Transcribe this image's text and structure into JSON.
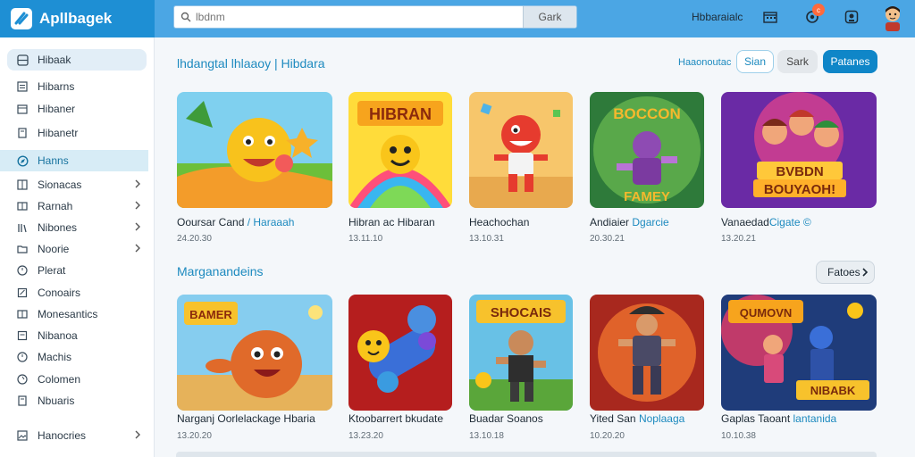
{
  "app": {
    "name": "Apllbagek"
  },
  "header": {
    "search_placeholder": "lbdnm",
    "search_button": "Gark",
    "link": "Hbbaraialc",
    "notification_badge": "c"
  },
  "sidebar": {
    "items": [
      {
        "label": "Hibaak",
        "icon": "grid-icon",
        "chevron": false
      },
      {
        "label": "Hibarns",
        "icon": "list-icon",
        "chevron": false
      },
      {
        "label": "Hibaner",
        "icon": "calendar-icon",
        "chevron": false
      },
      {
        "label": "Hibanetr",
        "icon": "document-icon",
        "chevron": false
      },
      {
        "label": "Hanns",
        "icon": "compass-icon",
        "chevron": false
      },
      {
        "label": "Sionacas",
        "icon": "columns-icon",
        "chevron": true
      },
      {
        "label": "Rarnah",
        "icon": "book-icon",
        "chevron": true
      },
      {
        "label": "Nibones",
        "icon": "library-icon",
        "chevron": true
      },
      {
        "label": "Noorie",
        "icon": "folder-icon",
        "chevron": true
      },
      {
        "label": "Plerat",
        "icon": "clock-icon",
        "chevron": false
      },
      {
        "label": "Conoairs",
        "icon": "file-icon",
        "chevron": false
      },
      {
        "label": "Monesantics",
        "icon": "book-icon",
        "chevron": false
      },
      {
        "label": "Nibanoa",
        "icon": "file-icon",
        "chevron": false
      },
      {
        "label": "Machis",
        "icon": "clock-icon",
        "chevron": false
      },
      {
        "label": "Colomen",
        "icon": "clock-icon",
        "chevron": false
      },
      {
        "label": "Nbuaris",
        "icon": "document-icon",
        "chevron": false
      },
      {
        "label": "Hanocries",
        "icon": "image-icon",
        "chevron": true
      }
    ]
  },
  "section1": {
    "title": "lhdangtal lhlaaoy | Hibdara",
    "link": "Haaonoutac",
    "btn1": "Sian",
    "btn2": "Sark",
    "btn3": "Patanes",
    "cards": [
      {
        "title": "Ooursar Cand",
        "tag": "/ Haraaah",
        "meta": "24.20.30"
      },
      {
        "title": "Hibran ac Hibaran",
        "tag": "",
        "meta": "13.11.10"
      },
      {
        "title": "Heachochan",
        "tag": "",
        "meta": "13.10.31"
      },
      {
        "title": "Andiaier",
        "tag": "Dgarcie",
        "meta": "20.30.21"
      },
      {
        "title": "Vanaedad",
        "tag": "Cigate ©",
        "meta": "13.20.21"
      }
    ]
  },
  "section2": {
    "title": "Marganandeins",
    "button": "Fatoes",
    "cards": [
      {
        "title": "Narganj Oorlelackage Hbaria",
        "tag": "",
        "meta": "13.20.20"
      },
      {
        "title": "Ktoobarrert bkudate",
        "tag": "",
        "meta": "13.23.20"
      },
      {
        "title": "Buadar Soanos",
        "tag": "",
        "meta": "13.10.18"
      },
      {
        "title": "Yited San",
        "tag": "Noplaaga",
        "meta": "10.20.20"
      },
      {
        "title": "Gaplas Taoant",
        "tag": "lantanida",
        "meta": "10.10.38"
      }
    ]
  },
  "colors": {
    "accent": "#1e8fd4",
    "header": "#4ba6e4",
    "primary_button": "#0f86c8"
  }
}
